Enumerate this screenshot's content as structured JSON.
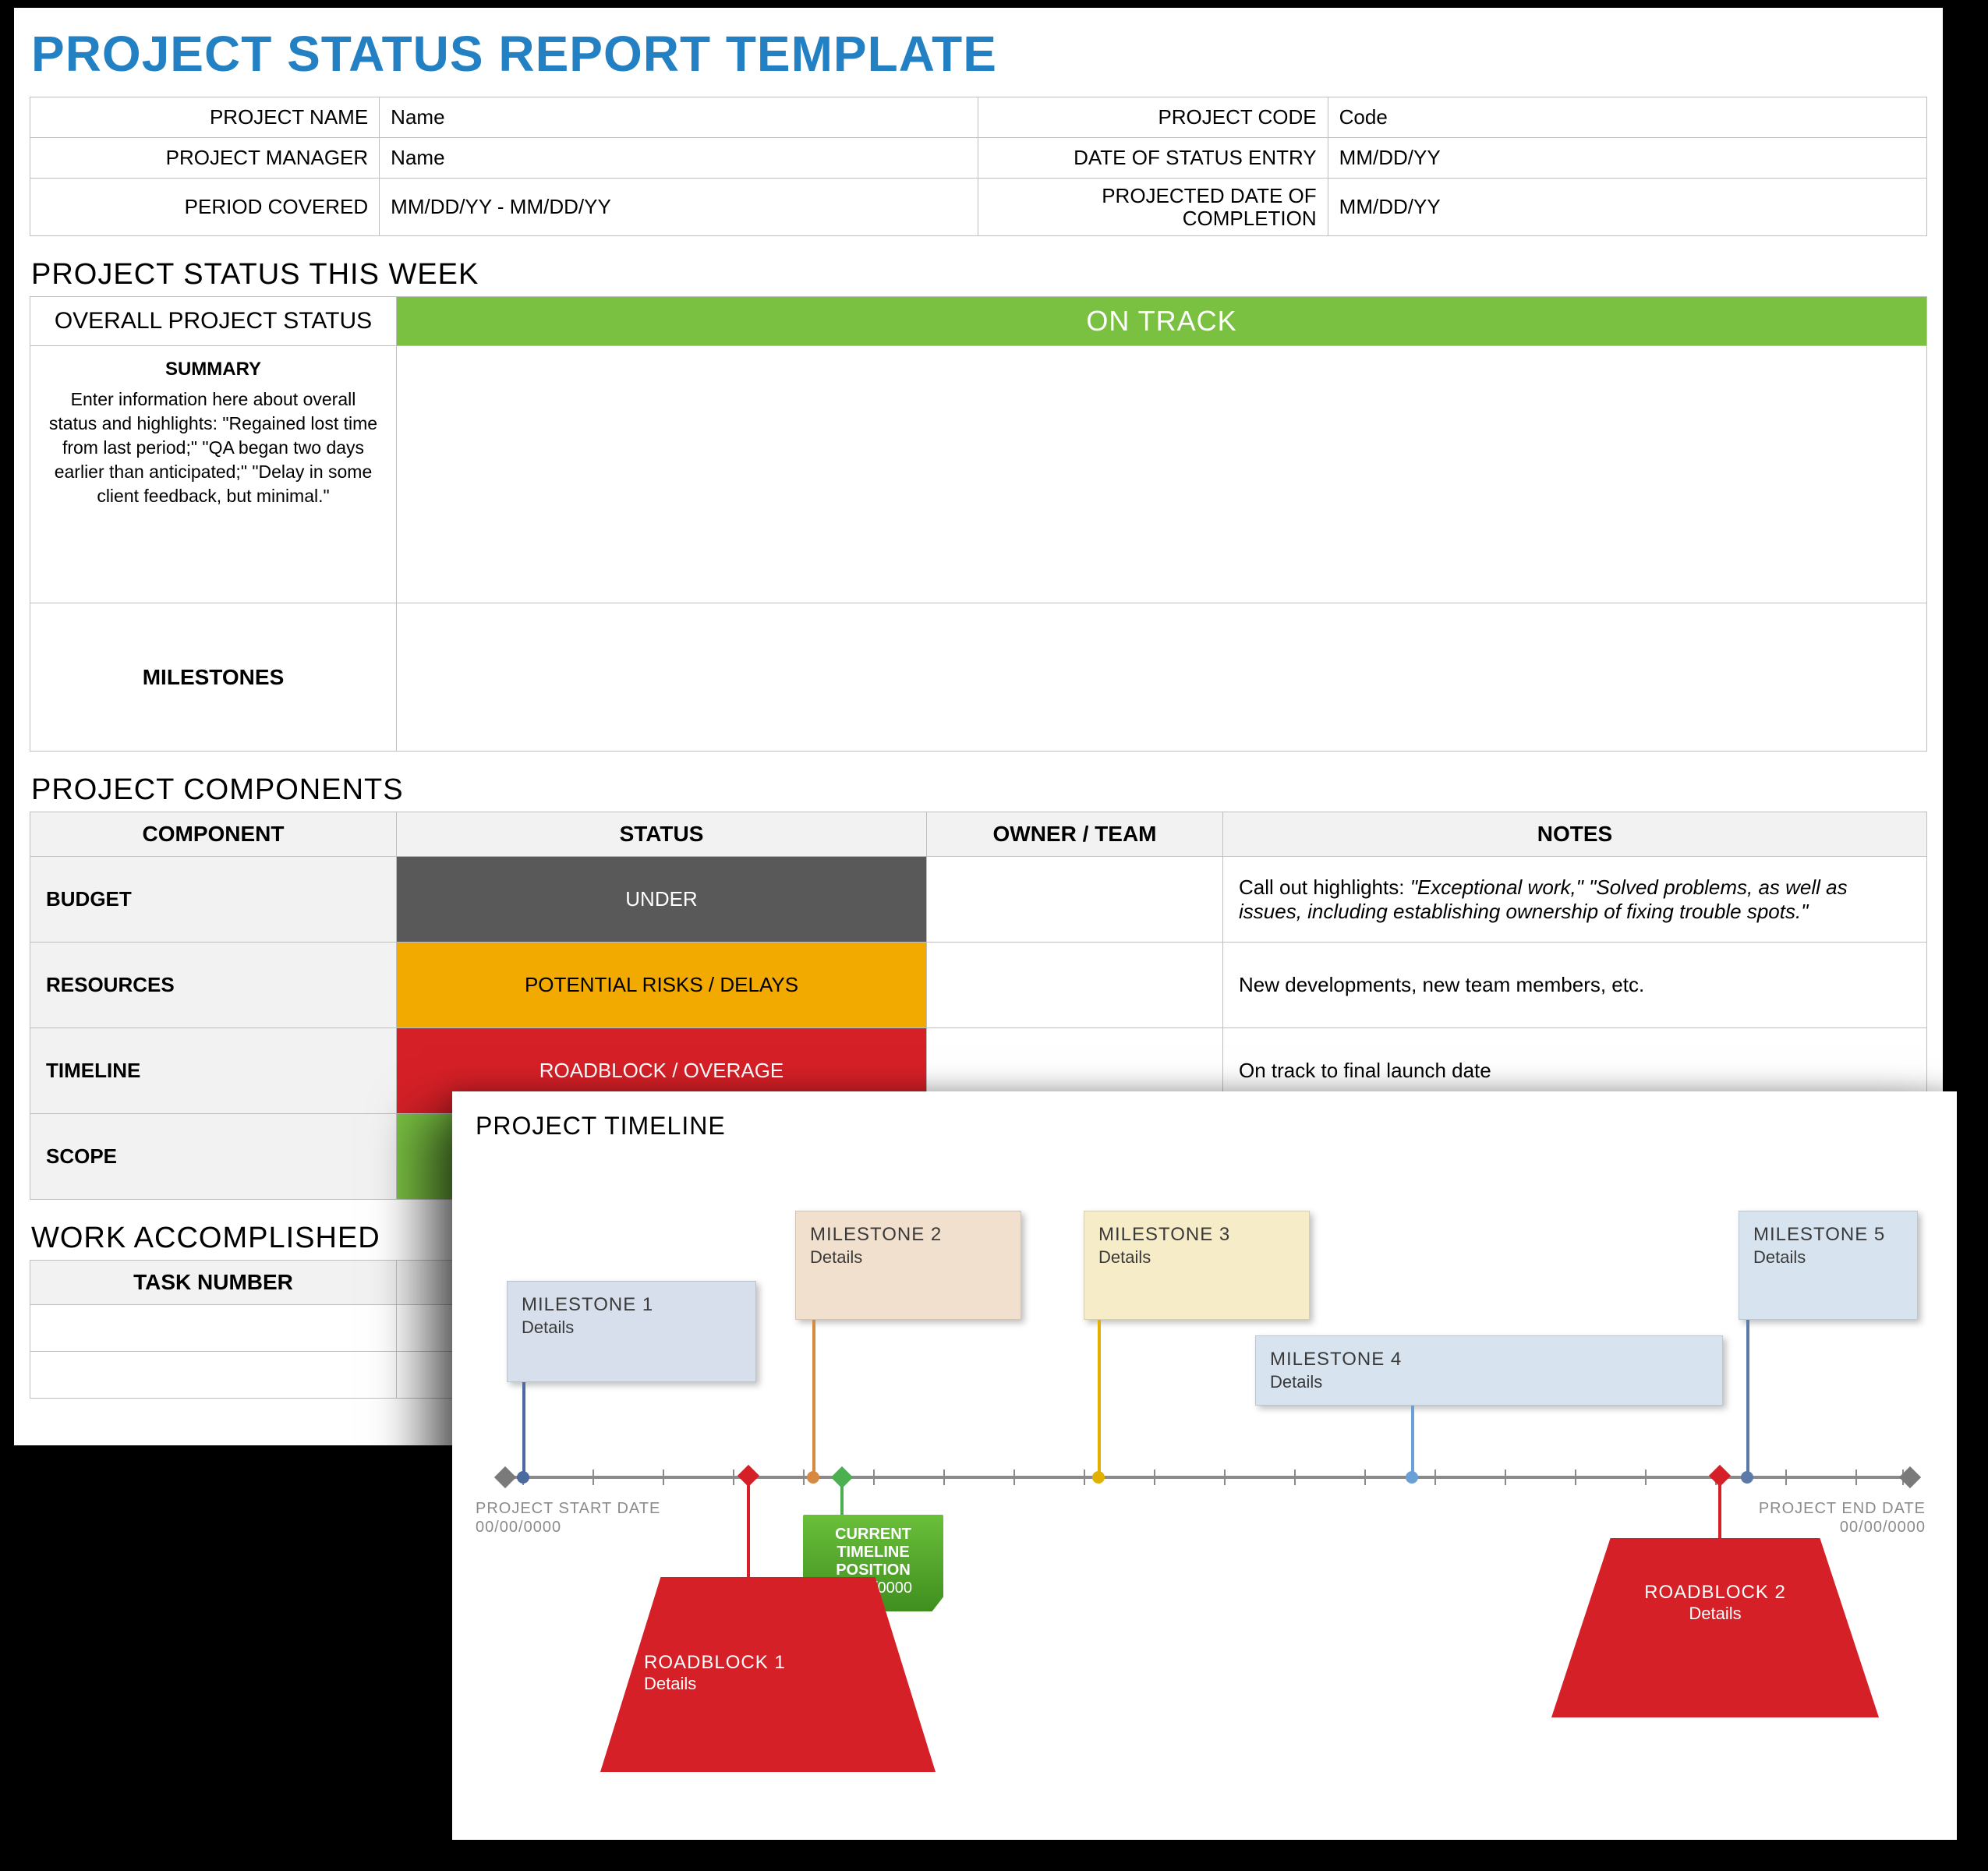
{
  "title": "PROJECT STATUS REPORT TEMPLATE",
  "meta": {
    "project_name_label": "PROJECT NAME",
    "project_name": "Name",
    "project_manager_label": "PROJECT MANAGER",
    "project_manager": "Name",
    "period_covered_label": "PERIOD COVERED",
    "period_covered": "MM/DD/YY - MM/DD/YY",
    "project_code_label": "PROJECT CODE",
    "project_code": "Code",
    "date_of_status_label": "DATE OF STATUS ENTRY",
    "date_of_status": "MM/DD/YY",
    "projected_completion_label": "PROJECTED DATE OF COMPLETION",
    "projected_completion": "MM/DD/YY"
  },
  "sections": {
    "status_week": "PROJECT STATUS THIS WEEK",
    "components": "PROJECT COMPONENTS",
    "work": "WORK ACCOMPLISHED"
  },
  "status_week": {
    "overall_label": "OVERALL PROJECT STATUS",
    "overall_value": "ON TRACK",
    "summary_label": "SUMMARY",
    "summary_hint": "Enter information here about overall status and highlights: \"Regained lost time from last period;\" \"QA began two days earlier than anticipated;\" \"Delay in some client feedback, but minimal.\"",
    "milestones_label": "MILESTONES"
  },
  "components": {
    "headers": {
      "component": "COMPONENT",
      "status": "STATUS",
      "owner": "OWNER / TEAM",
      "notes": "NOTES"
    },
    "rows": [
      {
        "name": "BUDGET",
        "status": "UNDER",
        "status_class": "status-under",
        "notes_prefix": "Call out highlights: ",
        "notes_em": "\"Exceptional work,\" \"Solved problems, as well as issues, including establishing ownership of fixing trouble spots.\""
      },
      {
        "name": "RESOURCES",
        "status": "POTENTIAL RISKS / DELAYS",
        "status_class": "status-risk",
        "notes": "New developments, new team members, etc."
      },
      {
        "name": "TIMELINE",
        "status": "ROADBLOCK / OVERAGE",
        "status_class": "status-road",
        "notes": "On track to final launch date"
      },
      {
        "name": "SCOPE",
        "status": "",
        "status_class": "status-scope",
        "notes": ""
      }
    ]
  },
  "work": {
    "task_number_label": "TASK NUMBER"
  },
  "timeline": {
    "title": "PROJECT TIMELINE",
    "start_label": "PROJECT START DATE",
    "start_value": "00/00/0000",
    "end_label": "PROJECT END DATE",
    "end_value": "00/00/0000",
    "current_label": "CURRENT TIMELINE POSITION",
    "current_value": "00/00/0000",
    "milestones": [
      {
        "title": "MILESTONE 1",
        "detail": "Details"
      },
      {
        "title": "MILESTONE 2",
        "detail": "Details"
      },
      {
        "title": "MILESTONE 3",
        "detail": "Details"
      },
      {
        "title": "MILESTONE 4",
        "detail": "Details"
      },
      {
        "title": "MILESTONE 5",
        "detail": "Details"
      }
    ],
    "roadblocks": [
      {
        "title": "ROADBLOCK 1",
        "detail": "Details"
      },
      {
        "title": "ROADBLOCK 2",
        "detail": "Details"
      }
    ]
  }
}
